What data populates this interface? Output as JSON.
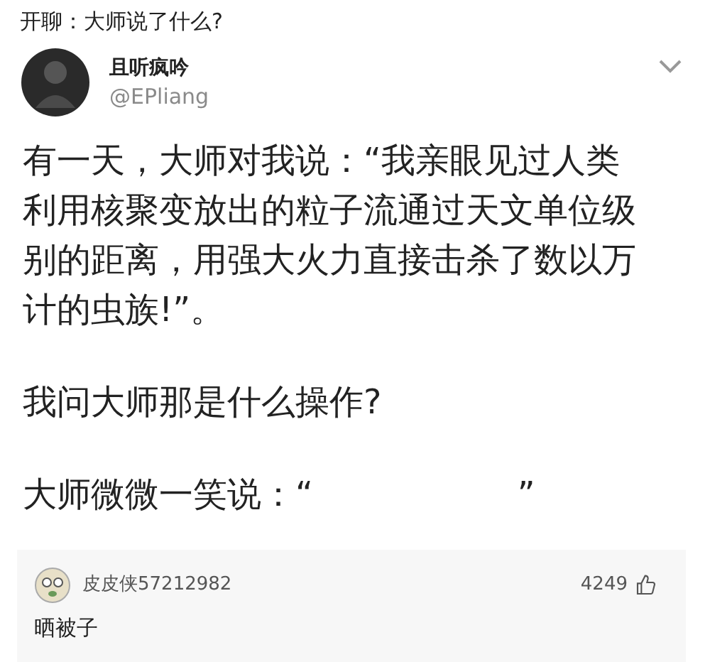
{
  "post_title": "开聊：大师说了什么?",
  "tweet": {
    "author": "且听疯吟",
    "handle": "@EPliang",
    "paragraphs": [
      "有一天，大师对我说：“我亲眼见过人类利用核聚变放出的粒子流通过天文单位级别的距离，用强大火力直接击杀了数以万计的虫族!”。",
      "我问大师那是什么操作?",
      "大师微微一笑说：“　　　　　　”"
    ]
  },
  "comment": {
    "user": "皮皮侠57212982",
    "likes": "4249",
    "text": "晒被子"
  }
}
